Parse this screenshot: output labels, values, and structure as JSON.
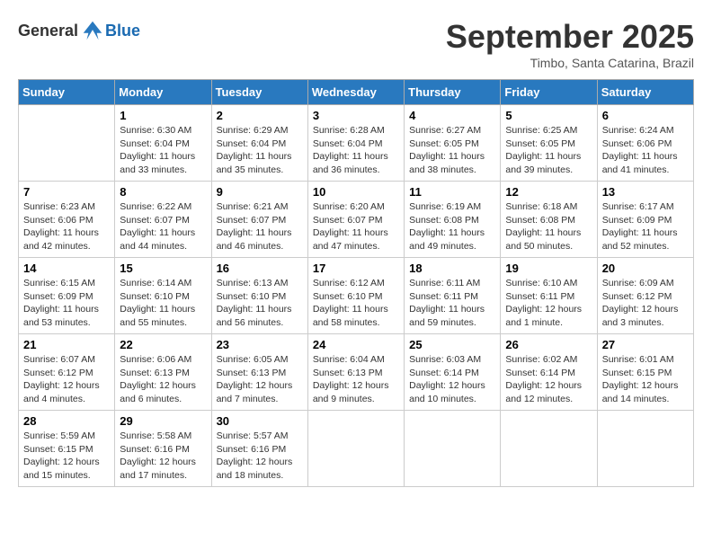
{
  "logo": {
    "general": "General",
    "blue": "Blue"
  },
  "title": "September 2025",
  "subtitle": "Timbo, Santa Catarina, Brazil",
  "days_header": [
    "Sunday",
    "Monday",
    "Tuesday",
    "Wednesday",
    "Thursday",
    "Friday",
    "Saturday"
  ],
  "weeks": [
    [
      {
        "num": "",
        "info": ""
      },
      {
        "num": "1",
        "info": "Sunrise: 6:30 AM\nSunset: 6:04 PM\nDaylight: 11 hours\nand 33 minutes."
      },
      {
        "num": "2",
        "info": "Sunrise: 6:29 AM\nSunset: 6:04 PM\nDaylight: 11 hours\nand 35 minutes."
      },
      {
        "num": "3",
        "info": "Sunrise: 6:28 AM\nSunset: 6:04 PM\nDaylight: 11 hours\nand 36 minutes."
      },
      {
        "num": "4",
        "info": "Sunrise: 6:27 AM\nSunset: 6:05 PM\nDaylight: 11 hours\nand 38 minutes."
      },
      {
        "num": "5",
        "info": "Sunrise: 6:25 AM\nSunset: 6:05 PM\nDaylight: 11 hours\nand 39 minutes."
      },
      {
        "num": "6",
        "info": "Sunrise: 6:24 AM\nSunset: 6:06 PM\nDaylight: 11 hours\nand 41 minutes."
      }
    ],
    [
      {
        "num": "7",
        "info": "Sunrise: 6:23 AM\nSunset: 6:06 PM\nDaylight: 11 hours\nand 42 minutes."
      },
      {
        "num": "8",
        "info": "Sunrise: 6:22 AM\nSunset: 6:07 PM\nDaylight: 11 hours\nand 44 minutes."
      },
      {
        "num": "9",
        "info": "Sunrise: 6:21 AM\nSunset: 6:07 PM\nDaylight: 11 hours\nand 46 minutes."
      },
      {
        "num": "10",
        "info": "Sunrise: 6:20 AM\nSunset: 6:07 PM\nDaylight: 11 hours\nand 47 minutes."
      },
      {
        "num": "11",
        "info": "Sunrise: 6:19 AM\nSunset: 6:08 PM\nDaylight: 11 hours\nand 49 minutes."
      },
      {
        "num": "12",
        "info": "Sunrise: 6:18 AM\nSunset: 6:08 PM\nDaylight: 11 hours\nand 50 minutes."
      },
      {
        "num": "13",
        "info": "Sunrise: 6:17 AM\nSunset: 6:09 PM\nDaylight: 11 hours\nand 52 minutes."
      }
    ],
    [
      {
        "num": "14",
        "info": "Sunrise: 6:15 AM\nSunset: 6:09 PM\nDaylight: 11 hours\nand 53 minutes."
      },
      {
        "num": "15",
        "info": "Sunrise: 6:14 AM\nSunset: 6:10 PM\nDaylight: 11 hours\nand 55 minutes."
      },
      {
        "num": "16",
        "info": "Sunrise: 6:13 AM\nSunset: 6:10 PM\nDaylight: 11 hours\nand 56 minutes."
      },
      {
        "num": "17",
        "info": "Sunrise: 6:12 AM\nSunset: 6:10 PM\nDaylight: 11 hours\nand 58 minutes."
      },
      {
        "num": "18",
        "info": "Sunrise: 6:11 AM\nSunset: 6:11 PM\nDaylight: 11 hours\nand 59 minutes."
      },
      {
        "num": "19",
        "info": "Sunrise: 6:10 AM\nSunset: 6:11 PM\nDaylight: 12 hours\nand 1 minute."
      },
      {
        "num": "20",
        "info": "Sunrise: 6:09 AM\nSunset: 6:12 PM\nDaylight: 12 hours\nand 3 minutes."
      }
    ],
    [
      {
        "num": "21",
        "info": "Sunrise: 6:07 AM\nSunset: 6:12 PM\nDaylight: 12 hours\nand 4 minutes."
      },
      {
        "num": "22",
        "info": "Sunrise: 6:06 AM\nSunset: 6:13 PM\nDaylight: 12 hours\nand 6 minutes."
      },
      {
        "num": "23",
        "info": "Sunrise: 6:05 AM\nSunset: 6:13 PM\nDaylight: 12 hours\nand 7 minutes."
      },
      {
        "num": "24",
        "info": "Sunrise: 6:04 AM\nSunset: 6:13 PM\nDaylight: 12 hours\nand 9 minutes."
      },
      {
        "num": "25",
        "info": "Sunrise: 6:03 AM\nSunset: 6:14 PM\nDaylight: 12 hours\nand 10 minutes."
      },
      {
        "num": "26",
        "info": "Sunrise: 6:02 AM\nSunset: 6:14 PM\nDaylight: 12 hours\nand 12 minutes."
      },
      {
        "num": "27",
        "info": "Sunrise: 6:01 AM\nSunset: 6:15 PM\nDaylight: 12 hours\nand 14 minutes."
      }
    ],
    [
      {
        "num": "28",
        "info": "Sunrise: 5:59 AM\nSunset: 6:15 PM\nDaylight: 12 hours\nand 15 minutes."
      },
      {
        "num": "29",
        "info": "Sunrise: 5:58 AM\nSunset: 6:16 PM\nDaylight: 12 hours\nand 17 minutes."
      },
      {
        "num": "30",
        "info": "Sunrise: 5:57 AM\nSunset: 6:16 PM\nDaylight: 12 hours\nand 18 minutes."
      },
      {
        "num": "",
        "info": ""
      },
      {
        "num": "",
        "info": ""
      },
      {
        "num": "",
        "info": ""
      },
      {
        "num": "",
        "info": ""
      }
    ]
  ]
}
